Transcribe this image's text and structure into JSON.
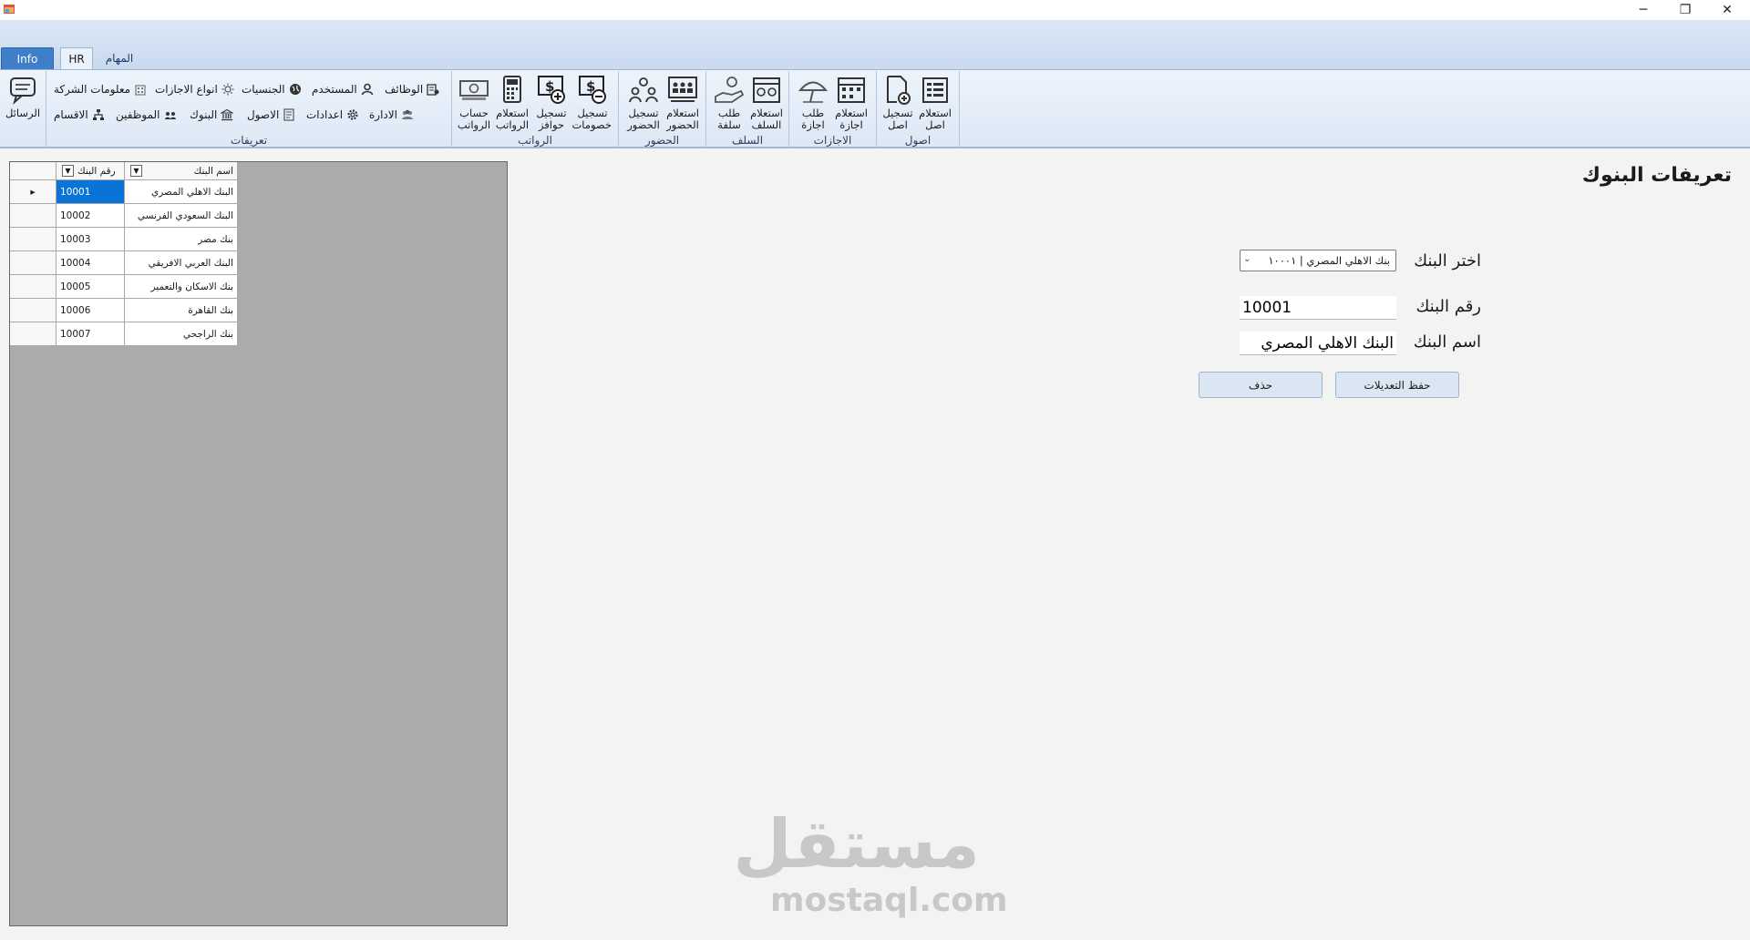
{
  "ribbon": {
    "tabs": [
      {
        "label": "Info"
      },
      {
        "label": "HR"
      },
      {
        "label": "المهام"
      }
    ],
    "groups": {
      "assets": {
        "label": "اصول",
        "buttons": [
          {
            "label": "استعلام\nاصل"
          },
          {
            "label": "تسجيل\nاصل"
          }
        ]
      },
      "leaves": {
        "label": "الاجازات",
        "buttons": [
          {
            "label": "استعلام\nاجازة"
          },
          {
            "label": "طلب\nاجازة"
          }
        ]
      },
      "advances": {
        "label": "السلف",
        "buttons": [
          {
            "label": "استعلام\nالسلف"
          },
          {
            "label": "طلب\nسلفة"
          }
        ]
      },
      "attendance": {
        "label": "الحضور",
        "buttons": [
          {
            "label": "استعلام\nالحضور"
          },
          {
            "label": "تسجيل\nالحضور"
          }
        ]
      },
      "salaries": {
        "label": "الرواتب",
        "buttons": [
          {
            "label": "تسجيل\nخصومات"
          },
          {
            "label": "تسجيل\nحوافز"
          },
          {
            "label": "استعلام\nالرواتب"
          },
          {
            "label": "حساب\nالرواتب"
          }
        ]
      },
      "definitions": {
        "label": "تعريفات",
        "row1": [
          {
            "label": "الوظائف"
          },
          {
            "label": "المستخدم"
          },
          {
            "label": "الجنسيات"
          },
          {
            "label": "انواع الاجازات"
          },
          {
            "label": "معلومات الشركة"
          }
        ],
        "row2": [
          {
            "label": "الادارة"
          },
          {
            "label": "اعدادات"
          },
          {
            "label": "الاصول"
          },
          {
            "label": "البنوك"
          },
          {
            "label": "الموظفين"
          },
          {
            "label": "الاقسام"
          }
        ]
      },
      "messages": {
        "label": "الرسائل"
      }
    }
  },
  "grid": {
    "columns": {
      "number": "رقم البنك",
      "name": "اسم البنك"
    },
    "rows": [
      {
        "number": "10001",
        "name": "البنك الاهلي المصري"
      },
      {
        "number": "10002",
        "name": "البنك السعودي الفرنسي"
      },
      {
        "number": "10003",
        "name": "بنك مصر"
      },
      {
        "number": "10004",
        "name": "البنك العربي الافريقي"
      },
      {
        "number": "10005",
        "name": "بنك الاسكان والتعمير"
      },
      {
        "number": "10006",
        "name": "بنك القاهرة"
      },
      {
        "number": "10007",
        "name": "بنك الراجحي"
      }
    ]
  },
  "form": {
    "title": "تعريفات البنوك",
    "select_label": "اختر البنك",
    "select_value": "بنك الاهلي المصري | ١٠٠٠١",
    "number_label": "رقم البنك",
    "number_value": "10001",
    "name_label": "اسم البنك",
    "name_value": "البنك الاهلي المصري",
    "save_label": "حفظ التعديلات",
    "delete_label": "حذف"
  },
  "watermark": {
    "arabic": "مستقل",
    "latin": "mostaql.com"
  },
  "colors": {
    "accent": "#3f7fc9",
    "selection": "#0a74d6",
    "ribbon": "#dce7f5",
    "panel": "#ababab"
  }
}
